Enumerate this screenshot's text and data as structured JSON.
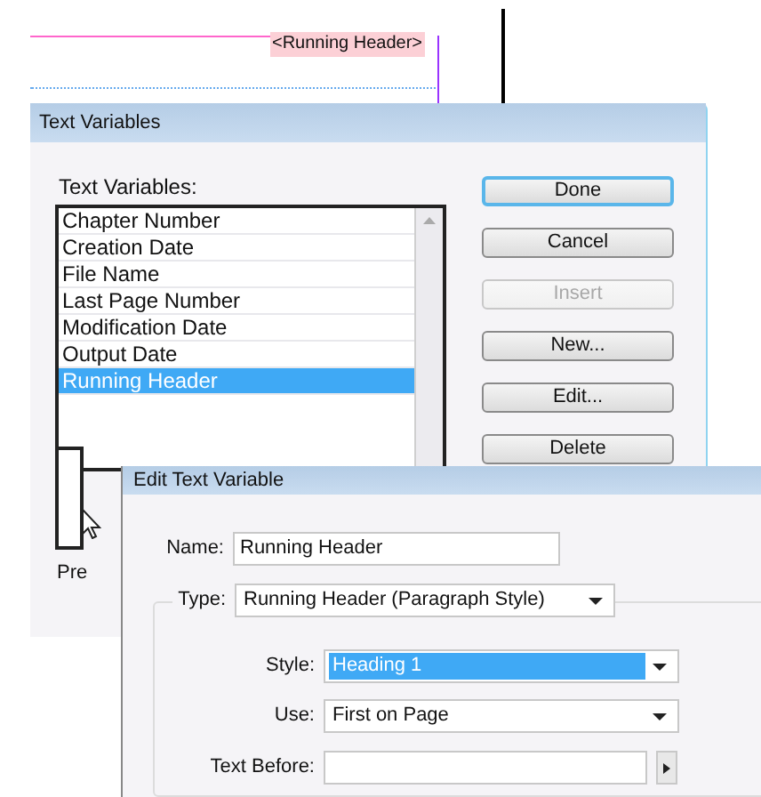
{
  "page": {
    "running_header_marker": "<Running Header>",
    "preview_label": "Pre"
  },
  "text_variables_dialog": {
    "title": "Text Variables",
    "list_label": "Text Variables:",
    "items": [
      {
        "label": "Chapter Number",
        "selected": false
      },
      {
        "label": "Creation Date",
        "selected": false
      },
      {
        "label": "File Name",
        "selected": false
      },
      {
        "label": "Last Page Number",
        "selected": false
      },
      {
        "label": "Modification Date",
        "selected": false
      },
      {
        "label": "Output Date",
        "selected": false
      },
      {
        "label": "Running Header",
        "selected": true
      }
    ],
    "buttons": [
      {
        "label": "Done",
        "default": true,
        "disabled": false
      },
      {
        "label": "Cancel",
        "default": false,
        "disabled": false
      },
      {
        "label": "Insert",
        "default": false,
        "disabled": true
      },
      {
        "label": "New...",
        "default": false,
        "disabled": false
      },
      {
        "label": "Edit...",
        "default": false,
        "disabled": false
      },
      {
        "label": "Delete",
        "default": false,
        "disabled": false
      }
    ]
  },
  "edit_dialog": {
    "title": "Edit Text Variable",
    "name": {
      "label": "Name:",
      "value": "Running Header"
    },
    "type": {
      "label": "Type:",
      "value": "Running Header (Paragraph Style)"
    },
    "style": {
      "label": "Style:",
      "value": "Heading 1",
      "highlighted": true
    },
    "use": {
      "label": "Use:",
      "value": "First on Page",
      "highlighted": false
    },
    "text_before": {
      "label": "Text Before:"
    }
  }
}
